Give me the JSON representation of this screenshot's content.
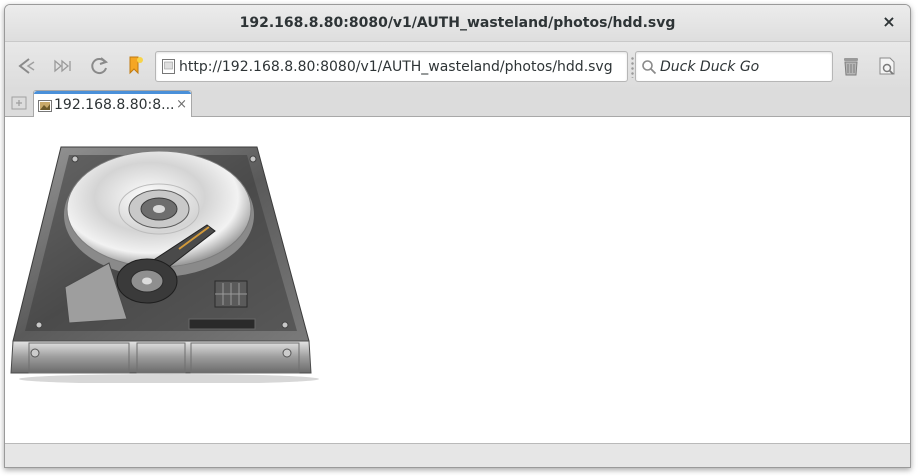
{
  "window": {
    "title": "192.168.8.80:8080/v1/AUTH_wasteland/photos/hdd.svg",
    "close_glyph": "×"
  },
  "toolbar": {
    "back_icon": "back-icon",
    "forward_icon": "forward-icon",
    "reload_icon": "reload-icon",
    "bookmark_icon": "bookmark-icon",
    "url": "http://192.168.8.80:8080/v1/AUTH_wasteland/photos/hdd.svg",
    "search_placeholder": "Duck Duck Go",
    "trash_icon": "trash-icon",
    "tools_icon": "tools-icon"
  },
  "tabs": [
    {
      "label": "192.168.8.80:8...",
      "close_glyph": "×",
      "active": true
    }
  ],
  "content": {
    "image_name": "hdd-illustration"
  },
  "colors": {
    "tab_accent": "#4a90d9",
    "bookmark": "#f5a623"
  }
}
